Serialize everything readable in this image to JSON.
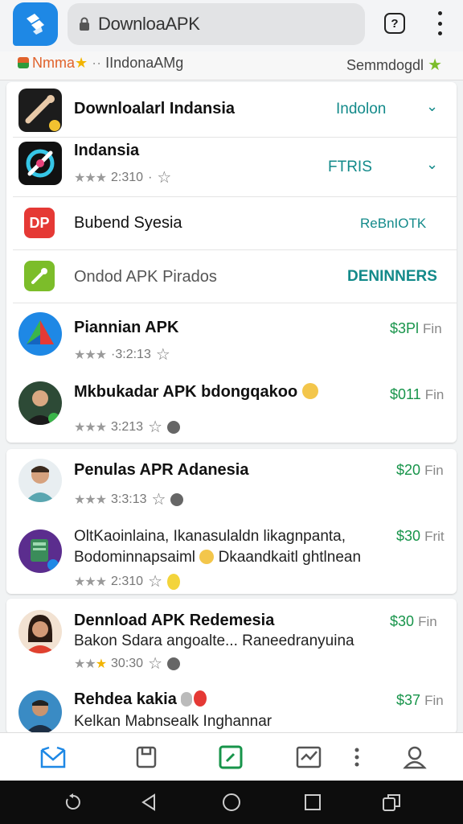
{
  "header": {
    "address": "DownloaAPK"
  },
  "strip": {
    "brand": "Nmma",
    "middle": "IIndonaAMg",
    "right": "Semmdogdl"
  },
  "card1": {
    "rows": [
      {
        "title": "Downloalarl Indansia",
        "action": "Indolon"
      },
      {
        "title": "Indansia",
        "meta": "2:310",
        "action": "FTRIS"
      },
      {
        "title": "Bubend Syesia",
        "action": "ReBnIOTK"
      },
      {
        "title": "Ondod APK Pirados",
        "action": "DENINNERS"
      },
      {
        "title": "Piannian APK",
        "meta": "·3:2:13",
        "price": "$3Pl",
        "unit": "Fin"
      },
      {
        "title": "Mkbukadar APK bdongqakoo",
        "meta": "3:213",
        "price": "$011",
        "unit": "Fin"
      }
    ]
  },
  "card2": {
    "rows": [
      {
        "title": "Penulas APR Adanesia",
        "meta": "3:3:13",
        "price": "$20",
        "unit": "Fin"
      },
      {
        "title": "OltKaoinlaina, Ikanasulaldn likagnpanta,",
        "sub": "Bodominnapsaiml",
        "sub2": "Dkaandkaitl ghtlnean",
        "meta": "2:310",
        "price": "$30",
        "unit": "Frit"
      }
    ]
  },
  "card3": {
    "rows": [
      {
        "title": "Dennload APK Redemesia",
        "sub": "Bakon Sdara angoalte... Raneedranyuina",
        "meta": "30:30",
        "price": "$30",
        "unit": "Fin"
      },
      {
        "title": "Rehdea kakia",
        "sub": "Kelkan Mabnsealk Inghannar",
        "price": "$37",
        "unit": "Fin"
      }
    ]
  },
  "colors": {
    "accent_teal": "#138a8a",
    "price_green": "#17944a",
    "brand_blue": "#1e88e5"
  },
  "nav_icons": [
    "inbox-icon",
    "clipboard-icon",
    "edit-icon",
    "chart-icon",
    "more-icon",
    "profile-icon"
  ],
  "system_icons": [
    "rotate-icon",
    "back-icon",
    "home-icon",
    "recents-icon",
    "screenshot-icon"
  ]
}
